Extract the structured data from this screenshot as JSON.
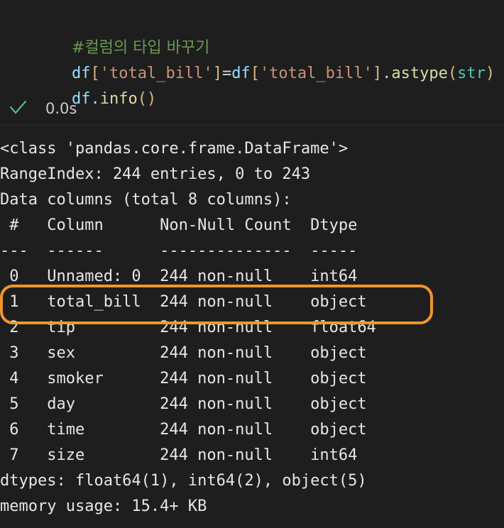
{
  "code": {
    "comment": "#컬럼의 타입 바꾸기",
    "line2": {
      "var1": "df",
      "bracket_open": "[",
      "key1": "'total_bill'",
      "bracket_close": "]",
      "assign": "=",
      "var2": "df",
      "key2": "'total_bill'",
      "dot": ".",
      "method": "astype",
      "paren_open": "(",
      "arg": "str",
      "paren_close": ")"
    },
    "line3": {
      "var": "df",
      "dot": ".",
      "method": "info",
      "parens": "()"
    }
  },
  "execution": {
    "status_icon": "checkmark-icon",
    "time": "0.0s",
    "check_color": "#4ec27a"
  },
  "output": {
    "lines": [
      "<class 'pandas.core.frame.DataFrame'>",
      "RangeIndex: 244 entries, 0 to 243",
      "Data columns (total 8 columns):",
      " #   Column      Non-Null Count  Dtype",
      "---  ------      --------------  -----",
      " 0   Unnamed: 0  244 non-null    int64",
      " 1   total_bill  244 non-null    object",
      " 2   tip         244 non-null    float64",
      " 3   sex         244 non-null    object",
      " 4   smoker      244 non-null    object",
      " 5   day         244 non-null    object",
      " 6   time        244 non-null    object",
      " 7   size        244 non-null    int64",
      "dtypes: float64(1), int64(2), object(5)",
      "memory usage: 15.4+ KB"
    ]
  },
  "highlight": {
    "color": "#f0952d",
    "highlighted_row": " 1   total_bill  244 non-null    object"
  }
}
